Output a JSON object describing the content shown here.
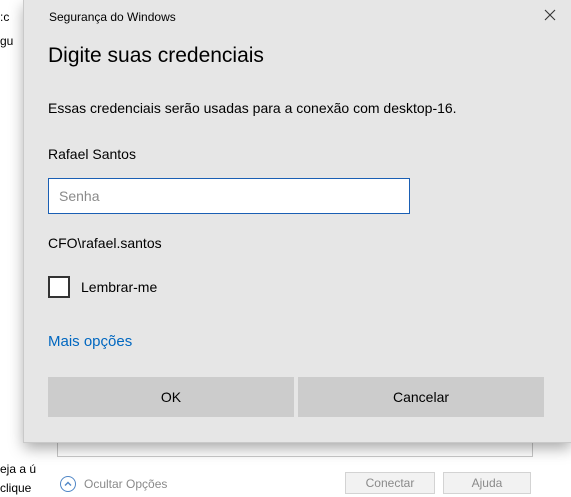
{
  "background_window": {
    "fragments": [
      ":c",
      "gu",
      "eja a ú",
      "clique"
    ],
    "hide_options_label": "Ocultar Opções",
    "connect_button": "Conectar",
    "help_button": "Ajuda"
  },
  "dialog": {
    "window_title": "Segurança do Windows",
    "heading": "Digite suas credenciais",
    "description": "Essas credenciais serão usadas para a conexão com desktop-16.",
    "username": "Rafael Santos",
    "password_placeholder": "Senha",
    "domain_user": "CFO\\rafael.santos",
    "remember_me_label": "Lembrar-me",
    "remember_me_checked": false,
    "more_options_link": "Mais opções",
    "ok_button": "OK",
    "cancel_button": "Cancelar",
    "link_color": "#0067c0",
    "input_border_color": "#1a5fb4"
  }
}
